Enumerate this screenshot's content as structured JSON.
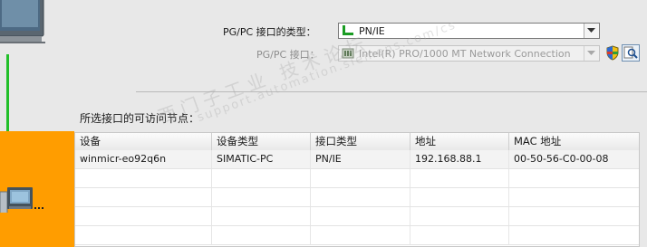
{
  "interface_type": {
    "label": "PG/PC 接口的类型：",
    "value": "PN/IE",
    "icon": "ethernet-icon"
  },
  "interface": {
    "label": "PG/PC 接口：",
    "value": "Intel(R) PRO/1000 MT Network Connection",
    "icon": "network-card-icon"
  },
  "nodes_title": "所选接口的可访问节点：",
  "table": {
    "columns": [
      "设备",
      "设备类型",
      "接口类型",
      "地址",
      "MAC 地址"
    ],
    "rows": [
      [
        "winmicr-eo92q6n",
        "SIMATIC-PC",
        "PN/IE",
        "192.168.88.1",
        "00-50-56-C0-00-08"
      ]
    ]
  },
  "watermark": {
    "text": "西门子工业 技术论坛",
    "url": "support.automation.siemens.com/cs"
  },
  "colors": {
    "orange": "#ff9d00",
    "green_line": "#22c02a"
  }
}
